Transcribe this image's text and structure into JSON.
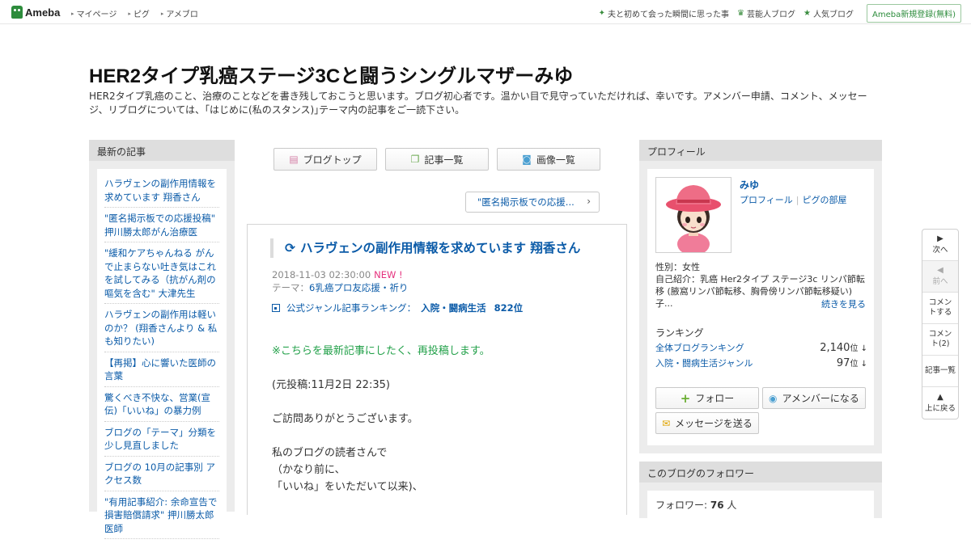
{
  "topbar": {
    "logo": "Ameba",
    "nav": [
      "マイページ",
      "ピグ",
      "アメブロ"
    ],
    "right_links": [
      "夫と初めて会った瞬間に思った事",
      "芸能人ブログ",
      "人気ブログ"
    ],
    "register": "Ameba新規登録(無料)"
  },
  "header": {
    "title": "HER2タイプ乳癌ステージ3Cと闘うシングルマザーみゆ",
    "description": "HER2タイプ乳癌のこと、治療のことなどを書き残しておこうと思います。ブログ初心者です。温かい目で見守っていただければ、幸いです。アメンバー申請、コメント、メッセージ、リブログについては、｢はじめに(私のスタンス)｣テーマ内の記事をご一読下さい。"
  },
  "left": {
    "heading": "最新の記事",
    "entries": [
      "ハラヴェンの副作用情報を求めています 翔香さん",
      "\"匿名掲示板での応援投稿\" 押川勝太郎がん治療医",
      "\"緩和ケアちゃんねる がんで止まらない吐き気はこれを試してみる（抗がん剤の嘔気を含む\" 大津先生",
      "ハラヴェンの副作用は軽いのか？ (翔香さんより & 私も知りたい)",
      "【再掲】心に響いた医師の言葉",
      "驚くべき不快な、営業(宣伝)「いいね」の暴力例",
      "ブログの「テーマ」分類を少し見直しました",
      "ブログの 10月の記事別 アクセス数",
      "\"有用記事紹介: 余命宣告で損害賠償請求\" 押川勝太郎医師"
    ]
  },
  "tabs": [
    {
      "label": "ブログトップ",
      "icon": "document-icon"
    },
    {
      "label": "記事一覧",
      "icon": "list-icon"
    },
    {
      "label": "画像一覧",
      "icon": "camera-icon"
    }
  ],
  "prev_post": "\"匿名掲示板での応援...",
  "article": {
    "title": "ハラヴェンの副作用情報を求めています 翔香さん",
    "date": "2018-11-03 02:30:00",
    "new_badge": "NEW !",
    "theme_label": "テーマ：",
    "theme": "6乳癌プロ友応援・祈り",
    "ranking_label": "公式ジャンル記事ランキング：",
    "ranking_genre": "入院・闘病生活",
    "ranking_value": "822位",
    "body": [
      "※こちらを最新記事にしたく、再投稿します。",
      "(元投稿:11月2日 22:35)",
      "ご訪問ありがとうございます。",
      "私のブログの読者さんで",
      "（かなり前に、",
      "「いいね」をいただいて以来)、"
    ]
  },
  "profile": {
    "heading": "プロフィール",
    "name": "みゆ",
    "link_profile": "プロフィール",
    "link_pig": "ピグの部屋",
    "gender": "性別：女性",
    "intro": "自己紹介：乳癌 Her2タイプ ステージ3c リンパ節転移 (腋窩リンパ節転移、胸骨傍リンパ節転移疑い) 子...",
    "more": "続きを見る",
    "ranking_heading": "ランキング",
    "rankings": [
      {
        "label": "全体ブログランキング",
        "value": "2,140",
        "unit": "位 ↓"
      },
      {
        "label": "入院・闘病生活ジャンル",
        "value": "97",
        "unit": "位 ↓"
      }
    ],
    "follow": "フォロー",
    "amember": "アメンバーになる",
    "message": "メッセージを送る"
  },
  "followers": {
    "heading": "このブログのフォロワー",
    "label": "フォロワー:",
    "count": "76",
    "unit": "人"
  },
  "sidenav": [
    {
      "label": "次へ",
      "icon": "arrow-right-icon"
    },
    {
      "label": "前へ",
      "icon": "arrow-left-icon"
    },
    {
      "label": "コメントする"
    },
    {
      "label": "コメント(2)"
    },
    {
      "label": "記事一覧"
    },
    {
      "label": "上に戻る",
      "icon": "arrow-up-icon"
    }
  ],
  "colors": {
    "accent": "#2d8c3c",
    "link": "#0b5ba8",
    "new": "#e5317d",
    "green_text": "#23a14a"
  }
}
